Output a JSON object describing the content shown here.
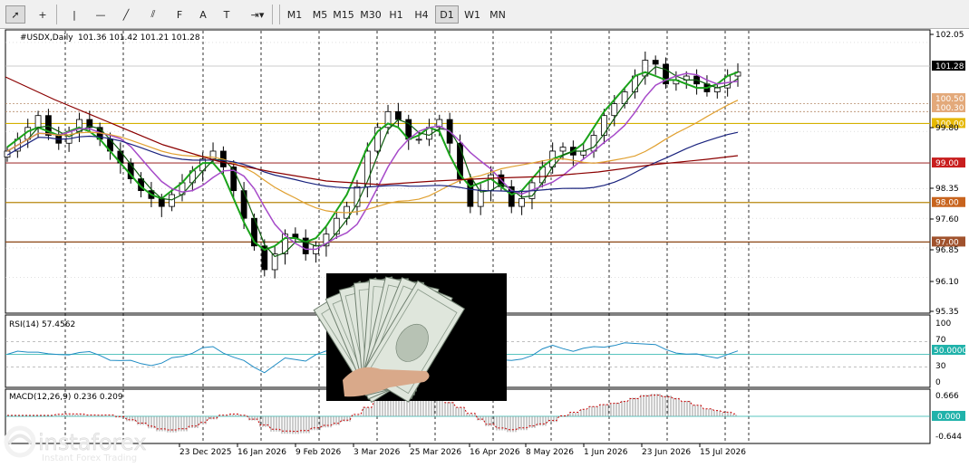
{
  "toolbar": {
    "tools": [
      {
        "name": "cursor-tool",
        "glyph": "➚"
      },
      {
        "name": "crosshair-tool",
        "glyph": "+"
      },
      {
        "name": "vertical-line-tool",
        "glyph": "|"
      },
      {
        "name": "horizontal-line-tool",
        "glyph": "—"
      },
      {
        "name": "trendline-tool",
        "glyph": "╱"
      },
      {
        "name": "channel-tool",
        "glyph": "⫽"
      },
      {
        "name": "fibonacci-tool",
        "glyph": "F"
      },
      {
        "name": "text-tool",
        "glyph": "A"
      },
      {
        "name": "text-label-tool",
        "glyph": "T"
      },
      {
        "name": "arrows-tool",
        "glyph": "⇥▾"
      }
    ],
    "timeframes": [
      "M1",
      "M5",
      "M15",
      "M30",
      "H1",
      "H4",
      "D1",
      "W1",
      "MN"
    ],
    "active_timeframe": "D1"
  },
  "header": {
    "symbol": "#USDX,Daily",
    "ohlc": "101.36 101.42 101.21 101.28"
  },
  "price_axis": {
    "ticks": [
      "102.05",
      "99.80",
      "98.35",
      "97.60",
      "96.85",
      "96.10",
      "95.35"
    ],
    "current": "101.28",
    "levels": [
      {
        "label": "100.50",
        "value": 100.5,
        "color": "#e3a97a",
        "line": "#b58c6a",
        "style": "dash"
      },
      {
        "label": "100.30",
        "value": 100.3,
        "color": "#e3a97a",
        "line": "#b58c6a",
        "style": "dash"
      },
      {
        "label": "100.00",
        "value": 100.0,
        "color": "#e6b800",
        "line": "#d4b000",
        "style": "solid"
      },
      {
        "label": "99.00",
        "value": 99.0,
        "color": "#c81e1e",
        "line": "#a63a3a",
        "style": "solid"
      },
      {
        "label": "98.00",
        "value": 98.0,
        "color": "#c8641e",
        "line": "#b8860b",
        "style": "solid"
      },
      {
        "label": "97.00",
        "value": 97.0,
        "color": "#a0522d",
        "line": "#8b4513",
        "style": "solid"
      }
    ]
  },
  "date_axis": [
    "23 Dec 2025",
    "16 Jan 2026",
    "9 Feb 2026",
    "3 Mar 2026",
    "25 Mar 2026",
    "16 Apr 2026",
    "8 May 2026",
    "1 Jun 2026",
    "23 Jun 2026",
    "15 Jul 2026"
  ],
  "rsi": {
    "label": "RSI(14) 57.4562",
    "ticks": [
      "100",
      "70",
      "30",
      "0"
    ],
    "current": "50.0000"
  },
  "macd": {
    "label": "MACD(12,26,9) 0.236 0.209",
    "ticks": [
      "0.666",
      "-0.644"
    ],
    "current": "0.000"
  },
  "watermark": {
    "brand": "instaforex",
    "tagline": "Instant Forex Trading"
  },
  "colors": {
    "candle_up": "#000000",
    "candle_down": "#000000",
    "ma_green": "#1aa31a",
    "ma_dark_green": "#0d5e0d",
    "ma_violet": "#a64ac9",
    "ma_orange": "#e0a030",
    "ma_navy": "#1a237e",
    "ma_darkred": "#8b0000",
    "rsi_line": "#1e8bc3",
    "macd_signal": "#c80000",
    "macd_hist": "#9a9a9a",
    "level_cyan": "#20b2aa"
  },
  "chart_data": {
    "type": "candlestick",
    "title": "#USDX,Daily",
    "ohlc_last": {
      "open": 101.36,
      "high": 101.42,
      "low": 101.21,
      "close": 101.28
    },
    "close_series": [
      99.3,
      99.6,
      99.9,
      100.2,
      99.7,
      99.5,
      99.8,
      100.1,
      99.9,
      99.6,
      99.3,
      99.0,
      98.6,
      98.3,
      98.1,
      97.9,
      98.2,
      98.5,
      98.8,
      99.1,
      99.3,
      98.9,
      98.3,
      97.6,
      96.9,
      96.3,
      96.7,
      97.2,
      97.1,
      96.7,
      96.9,
      97.2,
      97.6,
      97.9,
      98.4,
      99.3,
      99.9,
      100.3,
      100.1,
      99.6,
      99.6,
      99.9,
      100.1,
      99.5,
      98.6,
      97.9,
      98.3,
      98.7,
      98.4,
      97.9,
      98.1,
      98.5,
      98.9,
      99.3,
      99.4,
      99.2,
      99.3,
      99.7,
      100.2,
      100.5,
      100.8,
      101.2,
      101.6,
      101.5,
      101.0,
      101.1,
      101.2,
      101.0,
      100.8,
      100.9,
      101.2,
      101.3
    ],
    "ma_fast": [
      99.4,
      99.6,
      99.8,
      99.9,
      99.8,
      99.7,
      99.8,
      99.9,
      99.8,
      99.6,
      99.3,
      99.0,
      98.7,
      98.4,
      98.2,
      98.1,
      98.3,
      98.5,
      98.8,
      99.0,
      99.0,
      98.7,
      98.1,
      97.5,
      97.0,
      96.8,
      96.9,
      97.1,
      97.1,
      97.0,
      97.1,
      97.4,
      97.8,
      98.2,
      98.8,
      99.4,
      99.8,
      100.0,
      99.9,
      99.6,
      99.7,
      99.9,
      99.8,
      99.2,
      98.7,
      98.4,
      98.5,
      98.6,
      98.4,
      98.2,
      98.3,
      98.6,
      98.9,
      99.1,
      99.2,
      99.3,
      99.5,
      99.9,
      100.3,
      100.6,
      100.9,
      101.2,
      101.3,
      101.2,
      101.1,
      101.1,
      101.0,
      100.9,
      100.9,
      101.0,
      101.2,
      101.3
    ],
    "ylim": [
      95.35,
      102.3
    ],
    "x_ticks": [
      "23 Dec 2025",
      "16 Jan 2026",
      "9 Feb 2026",
      "3 Mar 2026",
      "25 Mar 2026",
      "16 Apr 2026",
      "8 May 2026",
      "1 Jun 2026",
      "23 Jun 2026",
      "15 Jul 2026"
    ],
    "levels": [
      100.5,
      100.3,
      100.0,
      99.0,
      98.0,
      97.0
    ],
    "grid": true
  }
}
